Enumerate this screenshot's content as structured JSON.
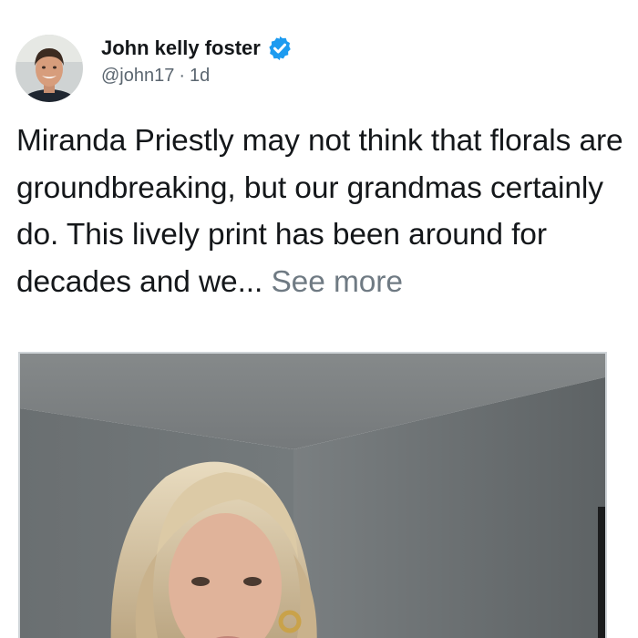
{
  "author": {
    "display_name": "John kelly foster",
    "verified": true,
    "handle": "@john17",
    "separator": "·",
    "time": "1d",
    "avatar_icon": "profile-photo"
  },
  "post": {
    "text": "Miranda Priestly may not think that florals are groundbreaking, but our grandmas certainly do. This lively print has been around for decades and we...",
    "see_more": "See more"
  },
  "media": {
    "type": "photo",
    "description_icon": "photo-icon"
  },
  "colors": {
    "verified": "#1d9bf0",
    "text": "#14171a",
    "secondary": "#5b6670",
    "see_more": "#6f7a83",
    "wall": "#6e7476"
  }
}
